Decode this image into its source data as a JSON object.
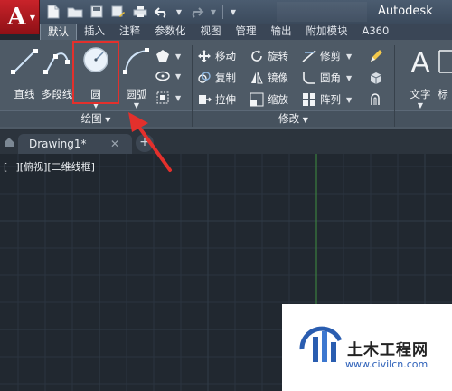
{
  "app": {
    "title": "Autodesk"
  },
  "quick_access": [
    "new-file-icon",
    "open-folder-icon",
    "save-icon",
    "save-as-icon",
    "print-icon",
    "undo-icon",
    "redo-icon"
  ],
  "ribbon_tabs": [
    "默认",
    "插入",
    "注释",
    "参数化",
    "视图",
    "管理",
    "输出",
    "附加模块",
    "A360"
  ],
  "draw_panel": {
    "title": "绘图",
    "tools": {
      "line": "直线",
      "polyline": "多段线",
      "circle": "圆",
      "arc": "圆弧"
    }
  },
  "modify_panel": {
    "title": "修改",
    "tools": {
      "move": "移动",
      "rotate": "旋转",
      "trim": "修剪",
      "copy": "复制",
      "mirror": "镜像",
      "fillet": "圆角",
      "stretch": "拉伸",
      "scale": "缩放",
      "array": "阵列"
    }
  },
  "annotation_panel": {
    "text": "文字",
    "partial": "标"
  },
  "document": {
    "tab_label": "Drawing1*",
    "close_label": "✕",
    "new_tab_label": "+"
  },
  "viewport": {
    "label": "[−][俯视][二维线框]"
  },
  "watermark": {
    "title": "土木工程网",
    "url": "www.civilcn.com"
  },
  "colors": {
    "highlight": "#e3302c",
    "brand_red": "#c9232a",
    "ribbon": "#4e5a66",
    "canvas": "#212830",
    "grid_axis_y": "#3f8f3f"
  }
}
